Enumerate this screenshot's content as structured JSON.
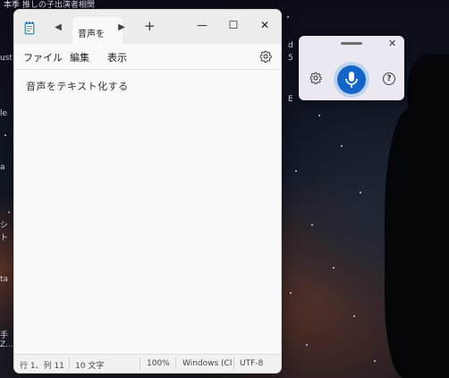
{
  "desktop": {
    "top_text": "本季 推しの子出演者相関",
    "left_fragments": [
      "ust",
      "le",
      "a",
      "シ",
      "ト",
      "ta",
      "手",
      "Z..."
    ],
    "right_fragments": [
      "d",
      "5",
      "E"
    ]
  },
  "notepad": {
    "tab_title": "音声を",
    "new_tab": "+",
    "menu": {
      "file": "ファイル",
      "edit": "編集",
      "view": "表示"
    },
    "content": "音声をテキスト化する",
    "status": {
      "position": "行 1、列 11",
      "chars": "10 文字",
      "zoom": "100%",
      "line_ending": "Windows (Cl",
      "encoding": "UTF-8"
    },
    "window_controls": {
      "minimize": "—",
      "maximize": "☐",
      "close": "✕"
    }
  },
  "voice_typing": {
    "close": "✕",
    "help": "?",
    "mic_color": "#1266c9"
  }
}
